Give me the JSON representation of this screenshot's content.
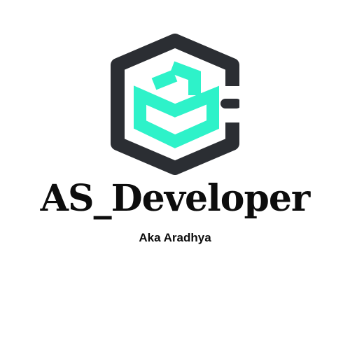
{
  "brand": {
    "name": "AS_Developer",
    "tagline": "Aka Aradhya"
  },
  "logo": {
    "icon": "hexagon-cube-icon",
    "outer_color": "#2b2e33",
    "inner_color": "#2ef2c9"
  }
}
